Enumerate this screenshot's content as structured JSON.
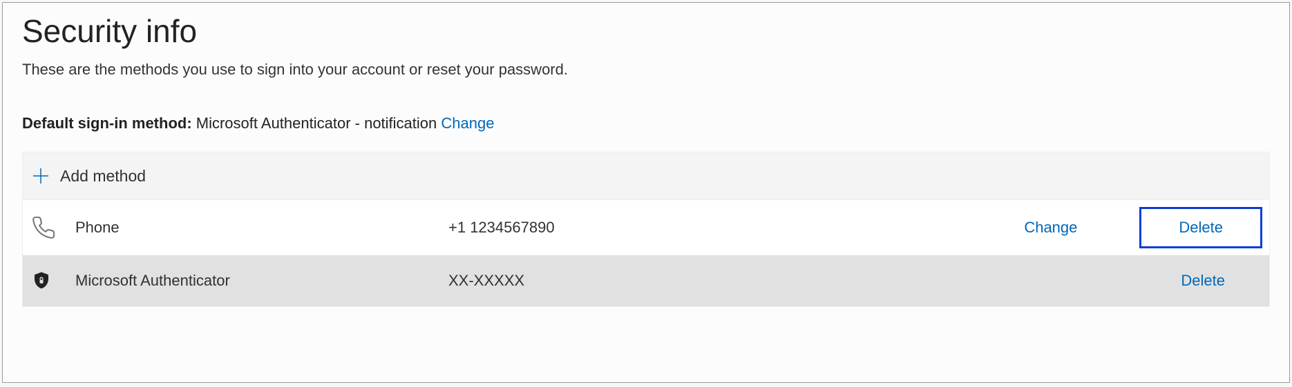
{
  "header": {
    "title": "Security info",
    "subtitle": "These are the methods you use to sign into your account or reset your password."
  },
  "default_method": {
    "label": "Default sign-in method: ",
    "value": "Microsoft Authenticator - notification",
    "change_label": "Change"
  },
  "add_method": {
    "label": "Add method"
  },
  "methods": [
    {
      "icon": "phone-icon",
      "name": "Phone",
      "value": "+1 1234567890",
      "change_label": "Change",
      "delete_label": "Delete"
    },
    {
      "icon": "authenticator-icon",
      "name": "Microsoft Authenticator",
      "value": "XX-XXXXX",
      "delete_label": "Delete"
    }
  ],
  "colors": {
    "link": "#0067b8",
    "highlight_border": "#0a3fd4",
    "alt_row": "#e1e1e1"
  }
}
